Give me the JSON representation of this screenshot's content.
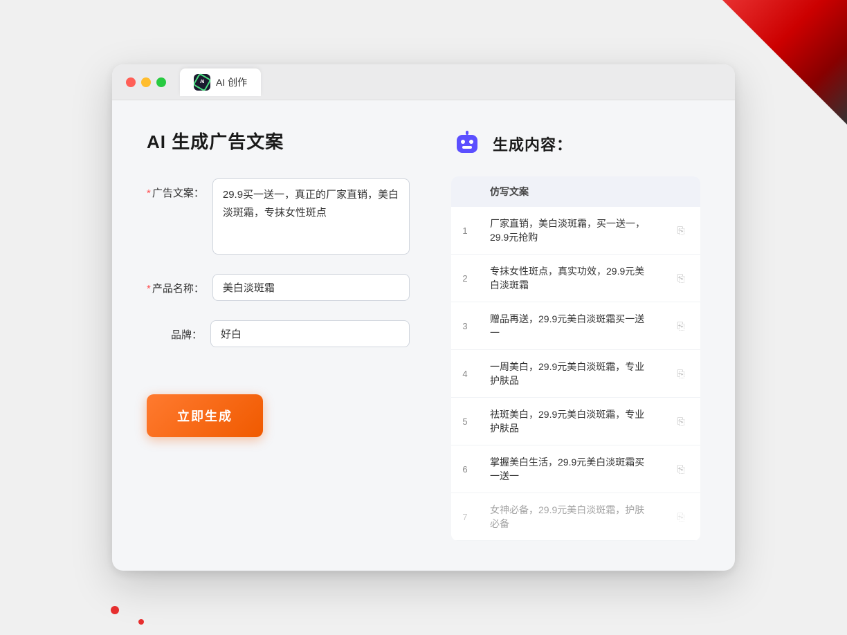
{
  "browser": {
    "tab_label": "AI 创作"
  },
  "left_panel": {
    "page_title": "AI 生成广告文案",
    "form": {
      "ad_copy_label": "广告文案：",
      "ad_copy_required": "*",
      "ad_copy_value": "29.9买一送一，真正的厂家直销，美白淡斑霜，专抹女性斑点",
      "product_name_label": "产品名称：",
      "product_name_required": "*",
      "product_name_value": "美白淡斑霜",
      "brand_label": "品牌：",
      "brand_value": "好白"
    },
    "generate_button": "立即生成"
  },
  "right_panel": {
    "title": "生成内容：",
    "table_header": "仿写文案",
    "results": [
      {
        "index": 1,
        "text": "厂家直销，美白淡斑霜，买一送一，29.9元抢购"
      },
      {
        "index": 2,
        "text": "专抹女性斑点，真实功效，29.9元美白淡斑霜"
      },
      {
        "index": 3,
        "text": "赠品再送，29.9元美白淡斑霜买一送一"
      },
      {
        "index": 4,
        "text": "一周美白，29.9元美白淡斑霜，专业护肤品"
      },
      {
        "index": 5,
        "text": "祛斑美白，29.9元美白淡斑霜，专业护肤品"
      },
      {
        "index": 6,
        "text": "掌握美白生活，29.9元美白淡斑霜买一送一"
      },
      {
        "index": 7,
        "text": "女神必备，29.9元美白淡斑霜，护肤必备"
      }
    ]
  }
}
